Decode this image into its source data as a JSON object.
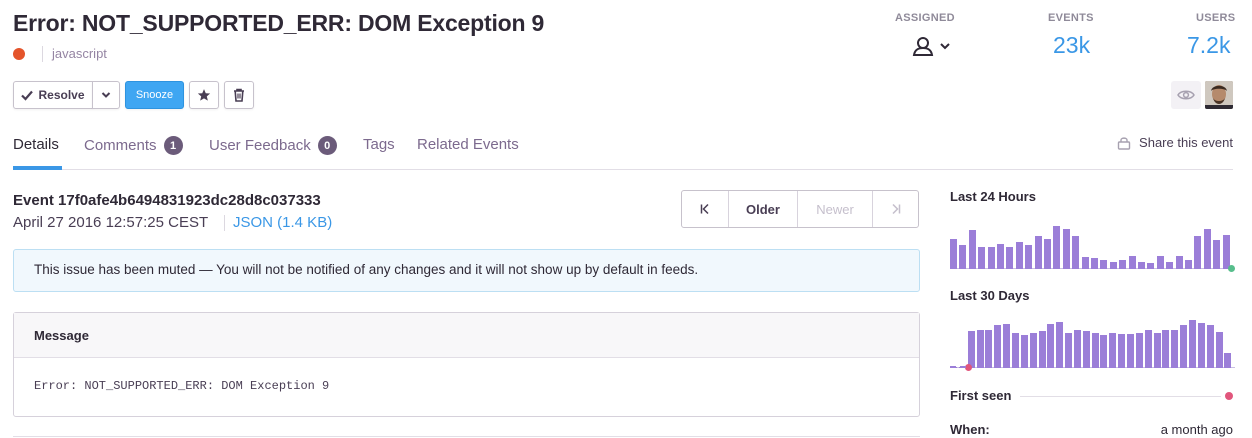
{
  "issue": {
    "title": "Error: NOT_SUPPORTED_ERR: DOM Exception 9",
    "platform": "javascript",
    "level_color": "#e4542b"
  },
  "stats": {
    "assigned_label": "ASSIGNED",
    "events_label": "EVENTS",
    "events_value": "23k",
    "users_label": "USERS",
    "users_value": "7.2k"
  },
  "actions": {
    "resolve_label": "Resolve",
    "snooze_label": "Snooze"
  },
  "tabs": [
    {
      "label": "Details",
      "active": true
    },
    {
      "label": "Comments",
      "badge": "1"
    },
    {
      "label": "User Feedback",
      "badge": "0"
    },
    {
      "label": "Tags"
    },
    {
      "label": "Related Events"
    }
  ],
  "share_label": "Share this event",
  "event": {
    "id_text": "Event 17f0afe4b6494831923dc28d8c037333",
    "date": "April 27 2016 12:57:25 CEST",
    "json_link": "JSON (1.4 KB)"
  },
  "pager": {
    "older": "Older",
    "newer": "Newer"
  },
  "alert_text": "This issue has been muted — You will not be notified of any changes and it will not show up by default in feeds.",
  "message": {
    "heading": "Message",
    "body": "Error: NOT_SUPPORTED_ERR: DOM Exception 9"
  },
  "sidebar": {
    "last24_title": "Last 24 Hours",
    "last24_values": [
      0.68,
      0.55,
      0.88,
      0.5,
      0.5,
      0.56,
      0.5,
      0.61,
      0.55,
      0.74,
      0.68,
      0.98,
      0.92,
      0.75,
      0.28,
      0.25,
      0.2,
      0.17,
      0.2,
      0.3,
      0.16,
      0.14,
      0.3,
      0.16,
      0.3,
      0.2,
      0.75,
      0.9,
      0.66,
      0.78
    ],
    "last30_title": "Last 30 Days",
    "last30_values": [
      0.0,
      0.0,
      0.78,
      0.79,
      0.79,
      0.9,
      0.92,
      0.72,
      0.68,
      0.72,
      0.78,
      0.92,
      0.95,
      0.72,
      0.8,
      0.78,
      0.73,
      0.68,
      0.72,
      0.7,
      0.7,
      0.72,
      0.8,
      0.73,
      0.79,
      0.8,
      0.9,
      1.0,
      0.94,
      0.9,
      0.75,
      0.32
    ],
    "first_seen_label": "First seen",
    "when_label": "When:",
    "when_value": "a month ago"
  },
  "colors": {
    "accent": "#3a97e6",
    "snooze": "#3fa6f2",
    "spark_bar": "#9b7ed8",
    "spark_end_green": "#57be8c",
    "spark_start_pink": "#e1567c"
  }
}
